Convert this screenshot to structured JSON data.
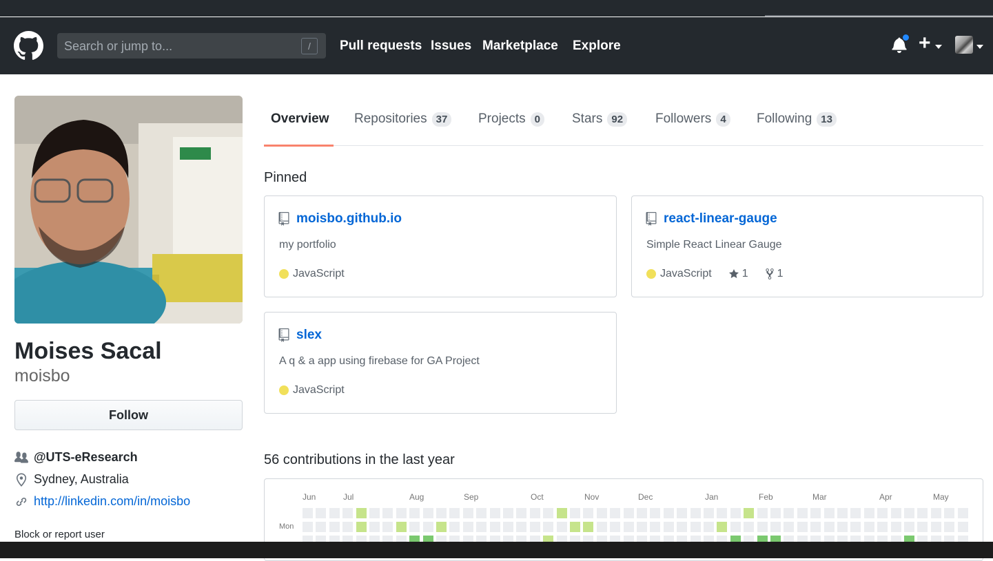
{
  "header": {
    "search_placeholder": "Search or jump to...",
    "search_shortcut": "/",
    "nav": [
      "Pull requests",
      "Issues",
      "Marketplace",
      "Explore"
    ],
    "plus_symbol": "+"
  },
  "profile": {
    "name": "Moises Sacal",
    "login": "moisbo",
    "follow_label": "Follow",
    "organization": "@UTS-eResearch",
    "location": "Sydney, Australia",
    "website": "http://linkedin.com/in/moisbo",
    "block_label": "Block or report user"
  },
  "tabs": [
    {
      "label": "Overview",
      "count": null
    },
    {
      "label": "Repositories",
      "count": "37"
    },
    {
      "label": "Projects",
      "count": "0"
    },
    {
      "label": "Stars",
      "count": "92"
    },
    {
      "label": "Followers",
      "count": "4"
    },
    {
      "label": "Following",
      "count": "13"
    }
  ],
  "pinned": {
    "title": "Pinned",
    "repos": [
      {
        "name": "moisbo.github.io",
        "description": "my portfolio",
        "language": "JavaScript",
        "language_color": "#f1e05a"
      },
      {
        "name": "react-linear-gauge",
        "description": "Simple React Linear Gauge",
        "language": "JavaScript",
        "language_color": "#f1e05a",
        "stars": "1",
        "forks": "1"
      },
      {
        "name": "slex",
        "description": "A q & a app using firebase for GA Project",
        "language": "JavaScript",
        "language_color": "#f1e05a"
      }
    ]
  },
  "contributions": {
    "title": "56 contributions in the last year",
    "months": [
      "Jun",
      "Jul",
      "Aug",
      "Sep",
      "Oct",
      "Nov",
      "Dec",
      "Jan",
      "Feb",
      "Mar",
      "Apr",
      "May"
    ],
    "day_label": "Mon",
    "colors": {
      "empty": "#ebedf0",
      "level1": "#c6e48b",
      "level2": "#7bc96f"
    }
  },
  "icons": [
    "github-logo-icon",
    "bell-icon",
    "plus-icon",
    "people-icon",
    "location-icon",
    "link-icon",
    "repo-icon",
    "star-icon",
    "fork-icon"
  ]
}
